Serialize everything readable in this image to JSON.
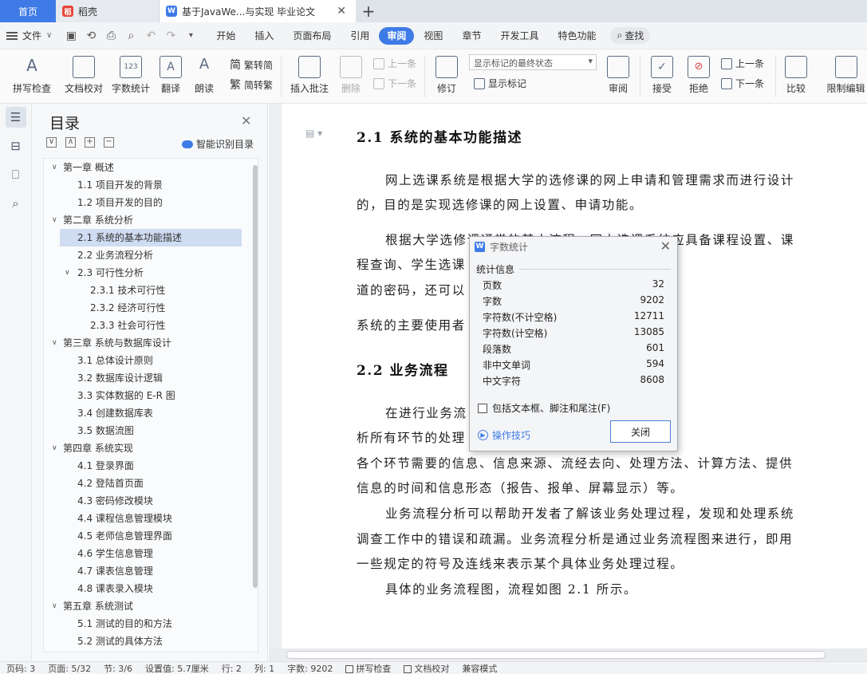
{
  "tabs": {
    "home": "首页",
    "docer": "稻壳",
    "document": "基于JavaWe...与实现 毕业论文",
    "add": "+"
  },
  "menu": {
    "file": "文件",
    "items": [
      "开始",
      "插入",
      "页面布局",
      "引用",
      "审阅",
      "视图",
      "章节",
      "开发工具",
      "特色功能"
    ],
    "active": "审阅",
    "search": "查找"
  },
  "ribbon": {
    "spell_check": "拼写检查",
    "doc_proof": "文档校对",
    "word_count": "字数统计",
    "translate": "翻译",
    "read_aloud": "朗读",
    "trad_simp": "繁转简",
    "simp_trad": "简转繁",
    "insert_comment": "插入批注",
    "delete": "删除",
    "prev": "上一条",
    "next": "下一条",
    "revise": "修订",
    "markup_dropdown": "显示标记的最终状态",
    "show_markup": "显示标记",
    "review": "审阅",
    "accept": "接受",
    "reject": "拒绝",
    "prev2": "上一条",
    "next2": "下一条",
    "compare": "比较",
    "restrict": "限制编辑"
  },
  "toc": {
    "title": "目录",
    "smart": "智能识别目录",
    "items": [
      {
        "label": "第一章 概述",
        "level": 1,
        "caret": "∨"
      },
      {
        "label": "1.1 项目开发的背景",
        "level": 2
      },
      {
        "label": "1.2 项目开发的目的",
        "level": 2
      },
      {
        "label": "第二章 系统分析",
        "level": 1,
        "caret": "∨"
      },
      {
        "label": "2.1 系统的基本功能描述",
        "level": 2,
        "selected": true
      },
      {
        "label": "2.2 业务流程分析",
        "level": 2
      },
      {
        "label": "2.3 可行性分析",
        "level": 2,
        "caret": "∨"
      },
      {
        "label": "2.3.1 技术可行性",
        "level": 3
      },
      {
        "label": "2.3.2 经济可行性",
        "level": 3
      },
      {
        "label": "2.3.3 社会可行性",
        "level": 3
      },
      {
        "label": "第三章 系统与数据库设计",
        "level": 1,
        "caret": "∨"
      },
      {
        "label": "3.1 总体设计原则",
        "level": 2
      },
      {
        "label": "3.2 数据库设计逻辑",
        "level": 2
      },
      {
        "label": "3.3 实体数据的 E-R 图",
        "level": 2
      },
      {
        "label": "3.4 创建数据库表",
        "level": 2
      },
      {
        "label": "3.5 数据流图",
        "level": 2
      },
      {
        "label": "第四章 系统实现",
        "level": 1,
        "caret": "∨"
      },
      {
        "label": "4.1 登录界面",
        "level": 2
      },
      {
        "label": "4.2 登陆首页面",
        "level": 2
      },
      {
        "label": "4.3 密码修改模块",
        "level": 2
      },
      {
        "label": "4.4 课程信息管理模块",
        "level": 2
      },
      {
        "label": "4.5 老师信息管理界面",
        "level": 2
      },
      {
        "label": "4.6 学生信息管理",
        "level": 2
      },
      {
        "label": "4.7 课表信息管理",
        "level": 2
      },
      {
        "label": "4.8 课表录入模块",
        "level": 2
      },
      {
        "label": "第五章 系统测试",
        "level": 1,
        "caret": "∨"
      },
      {
        "label": "5.1 测试的目的和方法",
        "level": 2
      },
      {
        "label": "5.2 测试的具体方法",
        "level": 2
      }
    ]
  },
  "doc": {
    "h1": "2.1 系统的基本功能描述",
    "p1a": "网上选课系统是根据大学的选修课的网上申请和管理需求而进行设计",
    "p1b": "的，目的是实现选修课的网上设置、申请功能。",
    "p2a": "根据大学选修课通常的基本流程，网上选课系统应具备课程设置、课",
    "p2b": "程查询、学生选课                    ，如果想设置只有自己知",
    "p2c": "道的密码，还可以",
    "p3": "系统的主要使用者                                     理员。",
    "h2": "2.2  业务流程",
    "p4a": "在进行业务流                          流动过程，逐个地调查分",
    "p4b": "析所有环节的处理                         对处理时间的要求，弄清",
    "p4c": "各个环节需要的信息、信息来源、流经去向、处理方法、计算方法、提供",
    "p4d": "信息的时间和信息形态（报告、报单、屏幕显示）等。",
    "p5a": "业务流程分析可以帮助开发者了解该业务处理过程，发现和处理系统",
    "p5b": "调查工作中的错误和疏漏。业务流程分析是通过业务流程图来进行，即用",
    "p5c": "一些规定的符号及连线来表示某个具体业务处理过程。",
    "p6": "具体的业务流程图，流程如图 2.1 所示。"
  },
  "dialog": {
    "title": "字数统计",
    "section": "统计信息",
    "stats": [
      {
        "label": "页数",
        "value": "32"
      },
      {
        "label": "字数",
        "value": "9202"
      },
      {
        "label": "字符数(不计空格)",
        "value": "12711"
      },
      {
        "label": "字符数(计空格)",
        "value": "13085"
      },
      {
        "label": "段落数",
        "value": "601"
      },
      {
        "label": "非中文单词",
        "value": "594"
      },
      {
        "label": "中文字符",
        "value": "8608"
      }
    ],
    "checkbox": "包括文本框、脚注和尾注(F)",
    "tips": "操作技巧",
    "close": "关闭"
  },
  "status": {
    "page_code": "页码: 3",
    "page": "页面: 5/32",
    "section": "节: 3/6",
    "setting": "设置值: 5.7厘米",
    "row": "行: 2",
    "col": "列: 1",
    "words": "字数: 9202",
    "spell": "拼写检查",
    "proof": "文档校对",
    "compat": "兼容模式"
  },
  "colors": {
    "accent": "#3f7be6",
    "toc_selected": "#cfdcf2"
  }
}
